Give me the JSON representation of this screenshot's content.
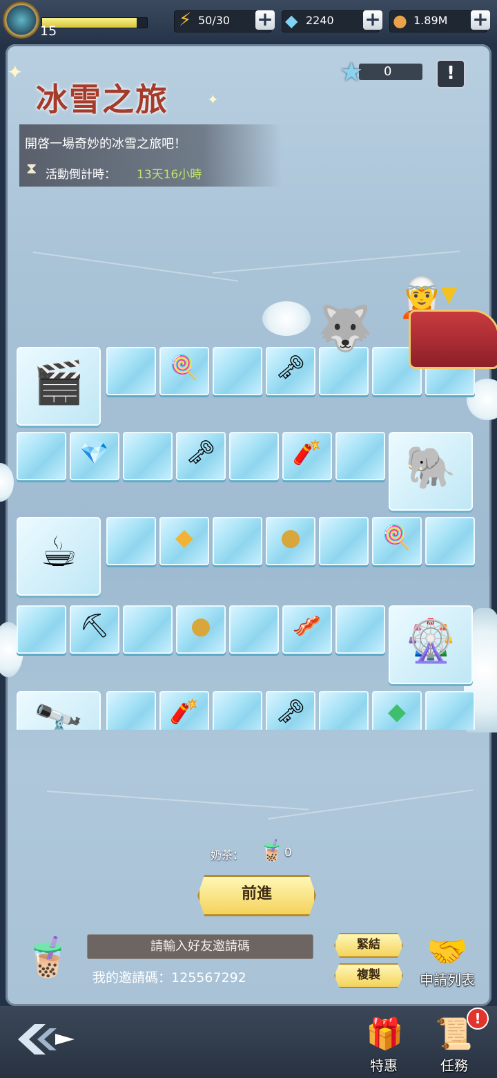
{
  "topbar": {
    "level": "15",
    "exp_progress": 0.9,
    "energy": "50/30",
    "diamonds": "2240",
    "coins": "1.89M"
  },
  "event": {
    "title": "冰雪之旅",
    "description": "開啓一場奇妙的冰雪之旅吧！",
    "countdown_label": "活動倒計時：",
    "countdown_value": "13天16小時",
    "stars": "0"
  },
  "board": {
    "rows": [
      [
        "cinema",
        "",
        "lollipop",
        "",
        "key",
        "",
        "",
        "",
        ""
      ],
      [
        "",
        "diamond",
        "",
        "key",
        "",
        "dynamite",
        "",
        "elephant-fountain"
      ],
      [
        "cocoa-cart",
        "",
        "gold-crystal",
        "",
        "coin",
        "",
        "lollipop",
        ""
      ],
      [
        "",
        "pickaxe",
        "",
        "coin",
        "",
        "bacon",
        "",
        "ferris-wheel"
      ],
      [
        "telescope-deck",
        "",
        "dynamite",
        "",
        "key",
        "",
        "green-crystal",
        ""
      ]
    ]
  },
  "controls": {
    "milk_tea_label": "奶茶：",
    "milk_tea_count": "0",
    "forward_button": "前進",
    "invite_placeholder": "請輸入好友邀請碼",
    "my_code_label": "我的邀請碼：",
    "my_code": "125567292",
    "bind_button": "緊結",
    "copy_button": "複製",
    "apply_list": "申請列表"
  },
  "footer": {
    "special_offer": "特惠",
    "tasks": "任務",
    "tasks_badge": "!"
  }
}
